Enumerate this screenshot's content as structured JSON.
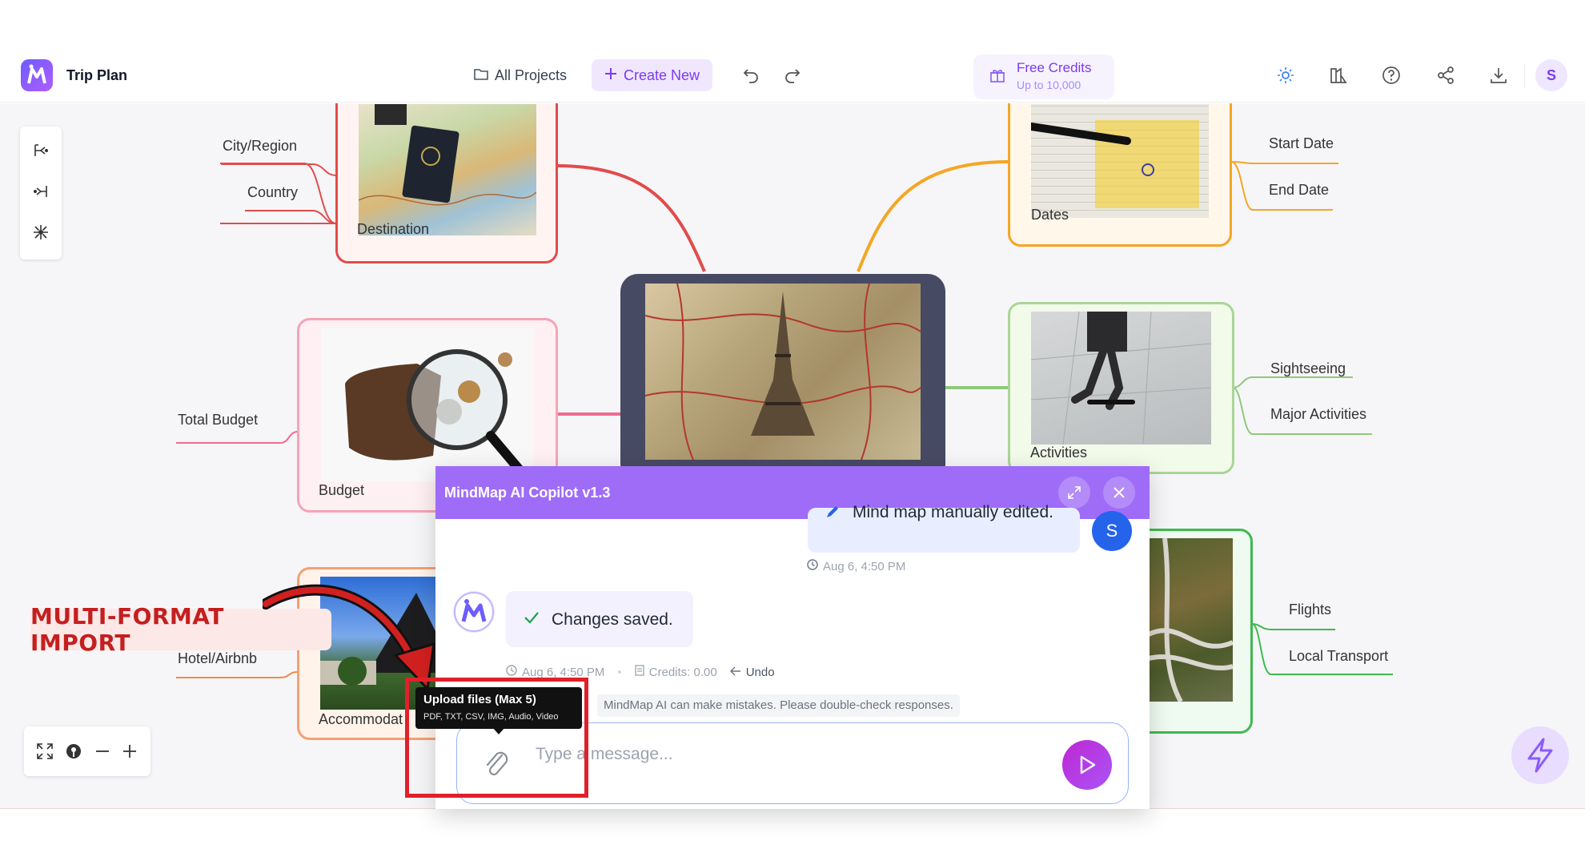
{
  "app": {
    "title": "Trip Plan"
  },
  "header": {
    "all_projects": "All Projects",
    "create_new": "Create New",
    "credits_title": "Free Credits",
    "credits_sub": "Up to 10,000",
    "avatar": "S"
  },
  "mindmap": {
    "destination": {
      "label": "Destination",
      "leaves": [
        "City/Region",
        "Country"
      ]
    },
    "dates": {
      "label": "Dates",
      "leaves": [
        "Start Date",
        "End Date"
      ]
    },
    "budget": {
      "label": "Budget",
      "leaves": [
        "Total Budget"
      ]
    },
    "activities": {
      "label": "Activities",
      "leaves": [
        "Sightseeing",
        "Major Activities"
      ]
    },
    "accommodation": {
      "label": "Accommodat",
      "leaves": [
        "Hotel/Airbnb"
      ]
    },
    "transport": {
      "leaves": [
        "Flights",
        "Local Transport"
      ]
    }
  },
  "annotation": {
    "text": "MULTI-FORMAT IMPORT"
  },
  "chat": {
    "title": "MindMap AI Copilot v1.3",
    "user_message": "Mind map manually edited.",
    "user_avatar": "S",
    "user_time": "Aug 6, 4:50 PM",
    "bot_message": "Changes saved.",
    "bot_time": "Aug 6, 4:50 PM",
    "credits": "Credits: 0.00",
    "undo": "Undo",
    "disclaimer": "MindMap AI can make mistakes. Please double-check responses.",
    "placeholder": "Type a message...",
    "tooltip_title": "Upload files (Max 5)",
    "tooltip_sub": "PDF, TXT, CSV, IMG, Audio, Video"
  },
  "colors": {
    "accent": "#7c3aed",
    "header_bar": "#9f6cf8",
    "destination": "#e24b4b",
    "dates": "#f5a623",
    "budget": "#f26b8e",
    "activities": "#8fc97a",
    "accommodation": "#f28a4b",
    "transport": "#3fb950",
    "annotation": "#c41f1f"
  }
}
